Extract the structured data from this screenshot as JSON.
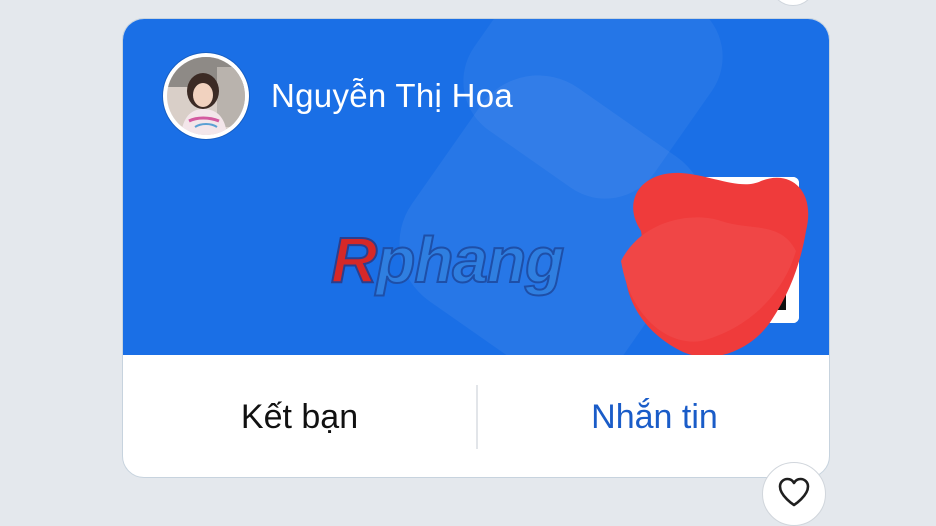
{
  "profile": {
    "name": "Nguyễn Thị Hoa",
    "avatar_icon": "avatar-photo"
  },
  "card": {
    "background_color": "#1a6fe6",
    "qr_icon": "qr-code"
  },
  "watermark": {
    "first_letter": "R",
    "rest": "phang"
  },
  "actions": {
    "add_friend_label": "Kết bạn",
    "message_label": "Nhắn tin",
    "message_color": "#1a5cc8"
  },
  "reaction": {
    "icon": "heart-outline-icon"
  }
}
